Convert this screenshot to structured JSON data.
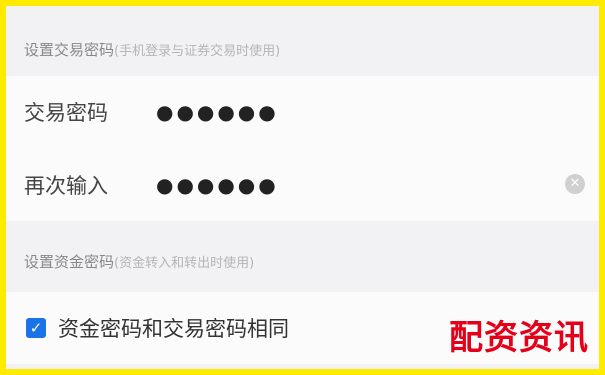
{
  "trade_password_section": {
    "title": "设置交易密码",
    "note": "(手机登录与证券交易时使用)"
  },
  "trade_password_field": {
    "label": "交易密码",
    "value": "●●●●●●"
  },
  "confirm_password_field": {
    "label": "再次输入",
    "value": "●●●●●●",
    "clear_icon": "clear-icon"
  },
  "fund_password_section": {
    "title": "设置资金密码",
    "note": "(资金转入和转出时使用)"
  },
  "same_password_option": {
    "checked": true,
    "label": "资金密码和交易密码相同"
  },
  "watermark": {
    "text": "配资资讯"
  },
  "colors": {
    "frame_border": "#ffeb00",
    "checkbox": "#1a73e8",
    "watermark": "#e5001a"
  }
}
